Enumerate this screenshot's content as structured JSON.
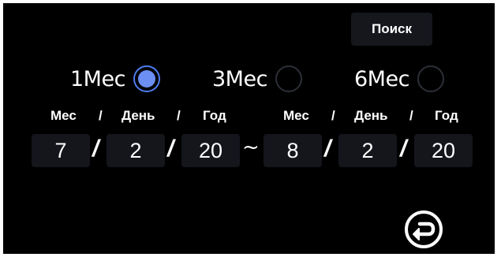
{
  "search_button": {
    "label": "Поиск"
  },
  "period_options": [
    {
      "label": "1Мес",
      "selected": true
    },
    {
      "label": "3Мес",
      "selected": false
    },
    {
      "label": "6Мес",
      "selected": false
    }
  ],
  "from": {
    "headers": {
      "month": "Мес",
      "day": "День",
      "year": "Год"
    },
    "month": "7",
    "day": "2",
    "year": "20"
  },
  "to": {
    "headers": {
      "month": "Мес",
      "day": "День",
      "year": "Год"
    },
    "month": "8",
    "day": "2",
    "year": "20"
  },
  "separators": {
    "header_slash": "/",
    "field_slash": "/",
    "range": "~"
  },
  "back_button": {
    "icon": "return-arrow-icon"
  },
  "colors": {
    "background": "#000000",
    "field_background": "#14161c",
    "radio_selected": "#6b8ff2",
    "radio_border": "#2c2f37"
  }
}
